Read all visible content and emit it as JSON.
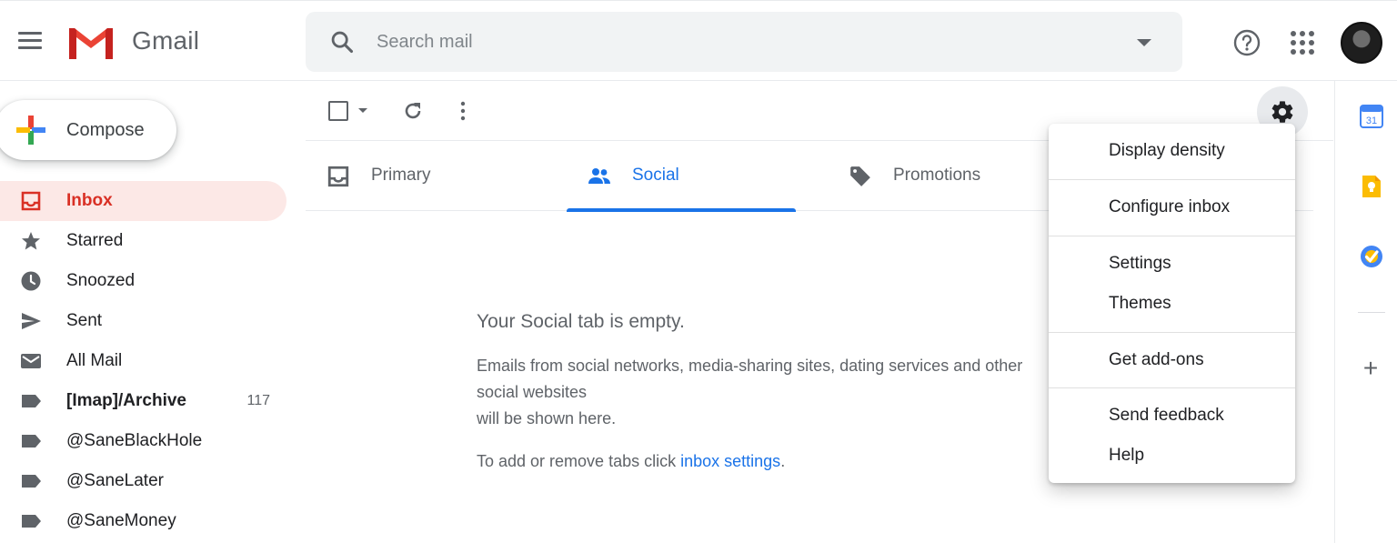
{
  "header": {
    "brand": "Gmail",
    "search_placeholder": "Search mail"
  },
  "compose": {
    "label": "Compose"
  },
  "nav": {
    "items": [
      {
        "label": "Inbox",
        "icon": "inbox-icon",
        "count": ""
      },
      {
        "label": "Starred",
        "icon": "star-icon",
        "count": ""
      },
      {
        "label": "Snoozed",
        "icon": "clock-icon",
        "count": ""
      },
      {
        "label": "Sent",
        "icon": "send-icon",
        "count": ""
      },
      {
        "label": "All Mail",
        "icon": "mail-icon",
        "count": ""
      },
      {
        "label": "[Imap]/Archive",
        "icon": "label-icon",
        "count": "117"
      },
      {
        "label": "@SaneBlackHole",
        "icon": "label-icon",
        "count": ""
      },
      {
        "label": "@SaneLater",
        "icon": "label-icon",
        "count": ""
      },
      {
        "label": "@SaneMoney",
        "icon": "label-icon",
        "count": ""
      }
    ]
  },
  "tabs": [
    {
      "label": "Primary",
      "icon": "inbox-icon"
    },
    {
      "label": "Social",
      "icon": "people-icon"
    },
    {
      "label": "Promotions",
      "icon": "tag-icon"
    }
  ],
  "empty_state": {
    "title": "Your Social tab is empty.",
    "body": "Emails from social networks, media-sharing sites, dating services and other social websites\nwill be shown here.",
    "tip_prefix": "To add or remove tabs click ",
    "tip_link": "inbox settings",
    "tip_suffix": "."
  },
  "settings_menu": {
    "items": [
      "Display density",
      "Configure inbox",
      "Settings",
      "Themes",
      "Get add-ons",
      "Send feedback",
      "Help"
    ]
  },
  "side_panel": {
    "calendar_date": "31",
    "add_symbol": "+"
  },
  "colors": {
    "accent": "#1a73e8",
    "inbox_active_bg": "#fce8e6",
    "inbox_active_text": "#d93025"
  }
}
